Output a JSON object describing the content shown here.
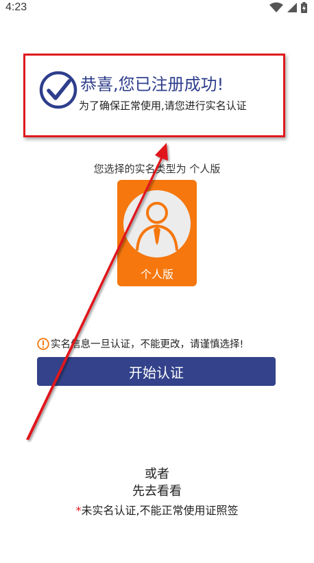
{
  "status_bar": {
    "time": "4:23",
    "icons": [
      "wifi-icon",
      "signal-icon",
      "battery-charging-icon"
    ]
  },
  "success_card": {
    "title": "恭喜,您已注册成功!",
    "subtitle": "为了确保正常使用,请您进行实名认证",
    "icon": "check-circle-icon",
    "accent_color": "#2e3e8c",
    "highlight_color": "#e0191e"
  },
  "account_type": {
    "caption": "您选择的实名类型为 个人版",
    "tile_label": "个人版",
    "tile_color": "#f5770e",
    "icon": "person-icon"
  },
  "warning": {
    "icon": "exclamation-circle-icon",
    "text": "实名信息一旦认证，不能更改，请谨慎选择!"
  },
  "start_button": {
    "label": "开始认证",
    "color": "#33428a"
  },
  "footer": {
    "or_text": "或者",
    "browse_label": "先去看看",
    "notice_star": "*",
    "notice_text": "未实名认证,不能正常使用证照签"
  },
  "annotation": {
    "icon": "red-arrow-icon",
    "color": "#e0191e"
  }
}
